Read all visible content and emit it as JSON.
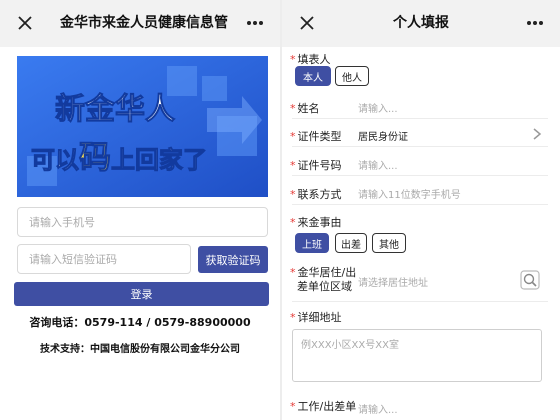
{
  "left": {
    "title": "金华市来金人员健康信息管",
    "banner": {
      "line1": "新金华人",
      "line2": "“码”上回家了",
      "line2_parts": [
        "可以",
        "码",
        "上回家了"
      ]
    },
    "phone_placeholder": "请输入手机号",
    "sms_placeholder": "请输入短信验证码",
    "get_code_label": "获取验证码",
    "login_label": "登录",
    "hotline": "咨询电话：0579-114 / 0579-88900000",
    "support": "技术支持：中国电信股份有限公司金华分公司"
  },
  "right": {
    "title": "个人填报",
    "reporter": {
      "label": "填表人",
      "options": [
        "本人",
        "他人"
      ],
      "selected": "本人"
    },
    "name": {
      "label": "姓名",
      "placeholder": "请输入..."
    },
    "id_type": {
      "label": "证件类型",
      "value": "居民身份证"
    },
    "id_number": {
      "label": "证件号码",
      "placeholder": "请输入..."
    },
    "contact": {
      "label": "联系方式",
      "placeholder": "请输入11位数字手机号"
    },
    "reason": {
      "label": "来金事由",
      "options": [
        "上班",
        "出差",
        "其他"
      ],
      "selected": "上班"
    },
    "area": {
      "label_line1": "金华居住/出",
      "label_line2": "差单位区域",
      "placeholder": "请选择居住地址"
    },
    "address": {
      "label": "详细地址",
      "placeholder": "例XXX小区XX号XX室"
    },
    "workplace": {
      "label": "工作/出差单",
      "placeholder": "请输入..."
    }
  },
  "colors": {
    "primary": "#3f4fa3",
    "banner_blue": "#2f6be0",
    "required": "#e53935",
    "titlebar": "#f2f2f2"
  },
  "icons": [
    "close-icon",
    "more-icon",
    "chevron-right-icon",
    "location-search-icon"
  ]
}
